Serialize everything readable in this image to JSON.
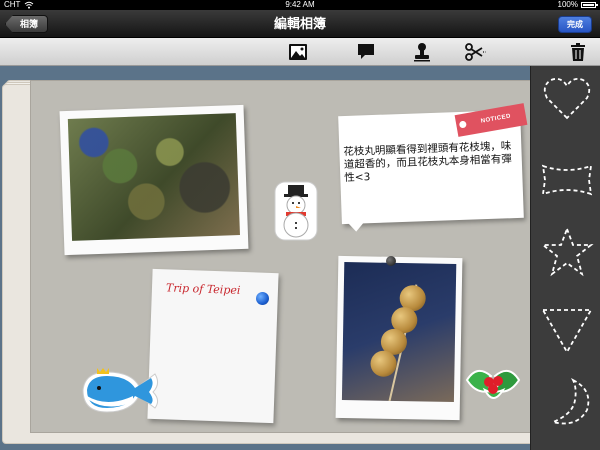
{
  "status_bar": {
    "carrier": "CHT",
    "time": "9:42 AM",
    "battery": "100%",
    "battery_level": 1.0,
    "icons": [
      "wifi-icon",
      "battery-icon"
    ]
  },
  "nav": {
    "back_label": "相簿",
    "title": "編輯相簿",
    "done_label": "完成"
  },
  "toolbar": {
    "tools": [
      "photo-icon",
      "speech-bubble-icon",
      "stamp-icon",
      "scissors-icon",
      "trash-icon"
    ]
  },
  "album": {
    "note_text": "花枝丸明顯看得到裡頭有花枝塊，味道超香的，而且花枝丸本身相當有彈性<3",
    "noticed_tag": "NOTICED",
    "paper_text": "Trip of Teipei",
    "stickers": [
      "snowman-sticker",
      "whale-sticker",
      "holly-sticker"
    ]
  },
  "side_panel": {
    "shapes": [
      "heart-shape",
      "banner-shape",
      "star-shape",
      "triangle-shape",
      "crescent-shape"
    ]
  },
  "colors": {
    "accent": "#2755c4",
    "noticed": "#e05260",
    "paper_text": "#c8262d"
  }
}
